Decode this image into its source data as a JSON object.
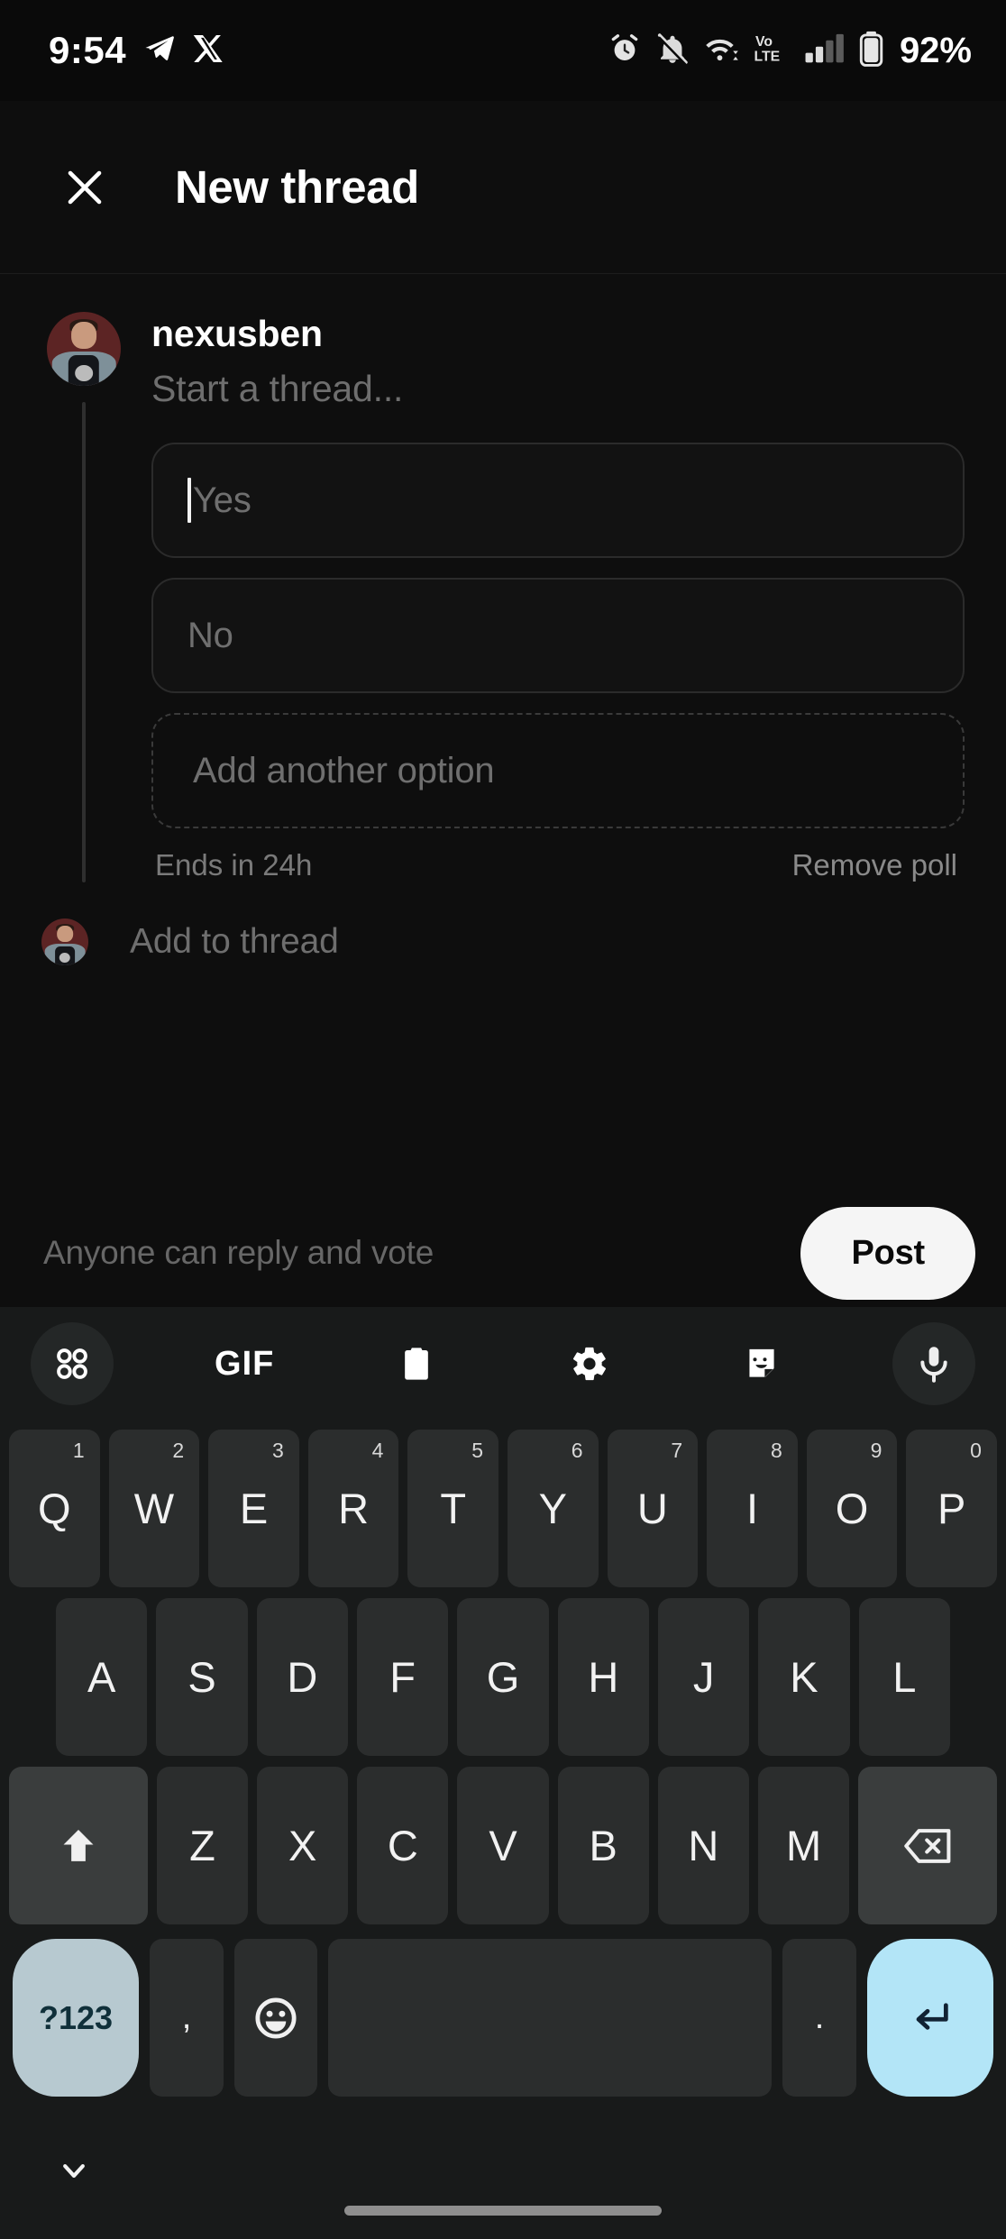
{
  "statusbar": {
    "time": "9:54",
    "battery_percent": "92%",
    "icons": [
      "telegram-icon",
      "x-twitter-icon",
      "alarm-icon",
      "bell-muted-icon",
      "wifi-icon",
      "volte-icon",
      "signal-icon",
      "battery-icon"
    ],
    "volte_top": "Vo",
    "volte_bottom": "LTE"
  },
  "appbar": {
    "close_label": "close-icon",
    "title": "New thread"
  },
  "composer": {
    "username": "nexusben",
    "thread_placeholder": "Start a thread...",
    "add_to_thread": "Add to thread"
  },
  "poll": {
    "options": [
      {
        "placeholder": "Yes",
        "caret": true,
        "dashed": false
      },
      {
        "placeholder": "No",
        "caret": false,
        "dashed": false
      },
      {
        "placeholder": "Add another option",
        "caret": false,
        "dashed": true
      }
    ],
    "ends_in": "Ends in 24h",
    "remove_label": "Remove poll"
  },
  "bottombar": {
    "audience": "Anyone can reply and vote",
    "post_label": "Post"
  },
  "keyboard": {
    "toolbar": [
      {
        "name": "clipboard-grid-icon",
        "type": "grid",
        "filled": true
      },
      {
        "name": "gif-icon",
        "type": "gif",
        "label": "GIF",
        "filled": false
      },
      {
        "name": "clipboard-icon",
        "type": "clipboard",
        "filled": false
      },
      {
        "name": "gear-icon",
        "type": "gear",
        "filled": false
      },
      {
        "name": "sticker-icon",
        "type": "sticker",
        "filled": false
      },
      {
        "name": "microphone-icon",
        "type": "mic",
        "filled": true
      }
    ],
    "row1": [
      {
        "key": "Q",
        "sup": "1"
      },
      {
        "key": "W",
        "sup": "2"
      },
      {
        "key": "E",
        "sup": "3"
      },
      {
        "key": "R",
        "sup": "4"
      },
      {
        "key": "T",
        "sup": "5"
      },
      {
        "key": "Y",
        "sup": "6"
      },
      {
        "key": "U",
        "sup": "7"
      },
      {
        "key": "I",
        "sup": "8"
      },
      {
        "key": "O",
        "sup": "9"
      },
      {
        "key": "P",
        "sup": "0"
      }
    ],
    "row2": [
      {
        "key": "A"
      },
      {
        "key": "S"
      },
      {
        "key": "D"
      },
      {
        "key": "F"
      },
      {
        "key": "G"
      },
      {
        "key": "H"
      },
      {
        "key": "J"
      },
      {
        "key": "K"
      },
      {
        "key": "L"
      }
    ],
    "row3": [
      {
        "key": "Z"
      },
      {
        "key": "X"
      },
      {
        "key": "C"
      },
      {
        "key": "V"
      },
      {
        "key": "B"
      },
      {
        "key": "N"
      },
      {
        "key": "M"
      }
    ],
    "shift_label": "shift-icon",
    "backspace_label": "backspace-icon",
    "num_label": "?123",
    "comma_label": ",",
    "emoji_label": "emoji-icon",
    "space_label": "",
    "period_label": ".",
    "enter_label": "enter-icon"
  },
  "navbar": {
    "hide_keyboard": "chevron-down-icon",
    "home_indicator": "home-indicator"
  },
  "colors": {
    "background": "#0e0e0e",
    "keyboard_bg": "#181a1a",
    "key_bg": "#2b2d2d",
    "accent_enter": "#b3e5f7",
    "accent_num": "#b7c9d0",
    "post_bg": "#f5f5f5",
    "avatar_bg": "#5c2424"
  }
}
